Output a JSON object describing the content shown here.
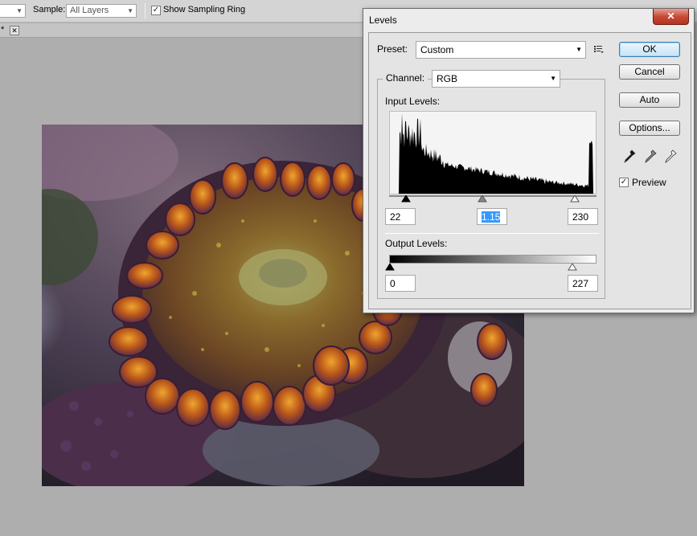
{
  "options_bar": {
    "sample_label": "Sample:",
    "sample_value": "All Layers",
    "show_ring_label": "Show Sampling Ring",
    "show_ring_checked": "✓"
  },
  "doc_tab": {
    "modified_marker": "*",
    "close_glyph": "✕"
  },
  "levels": {
    "title": "Levels",
    "close_glyph": "✕",
    "preset_label": "Preset:",
    "preset_value": "Custom",
    "channel_label": "Channel:",
    "channel_value": "RGB",
    "input_levels_label": "Input Levels:",
    "input_black": "22",
    "input_gamma": "1.15",
    "input_white": "230",
    "output_levels_label": "Output Levels:",
    "output_black": "0",
    "output_white": "227",
    "ok_label": "OK",
    "cancel_label": "Cancel",
    "auto_label": "Auto",
    "options_label": "Options...",
    "preview_label": "Preview",
    "preview_checked": "✓"
  }
}
